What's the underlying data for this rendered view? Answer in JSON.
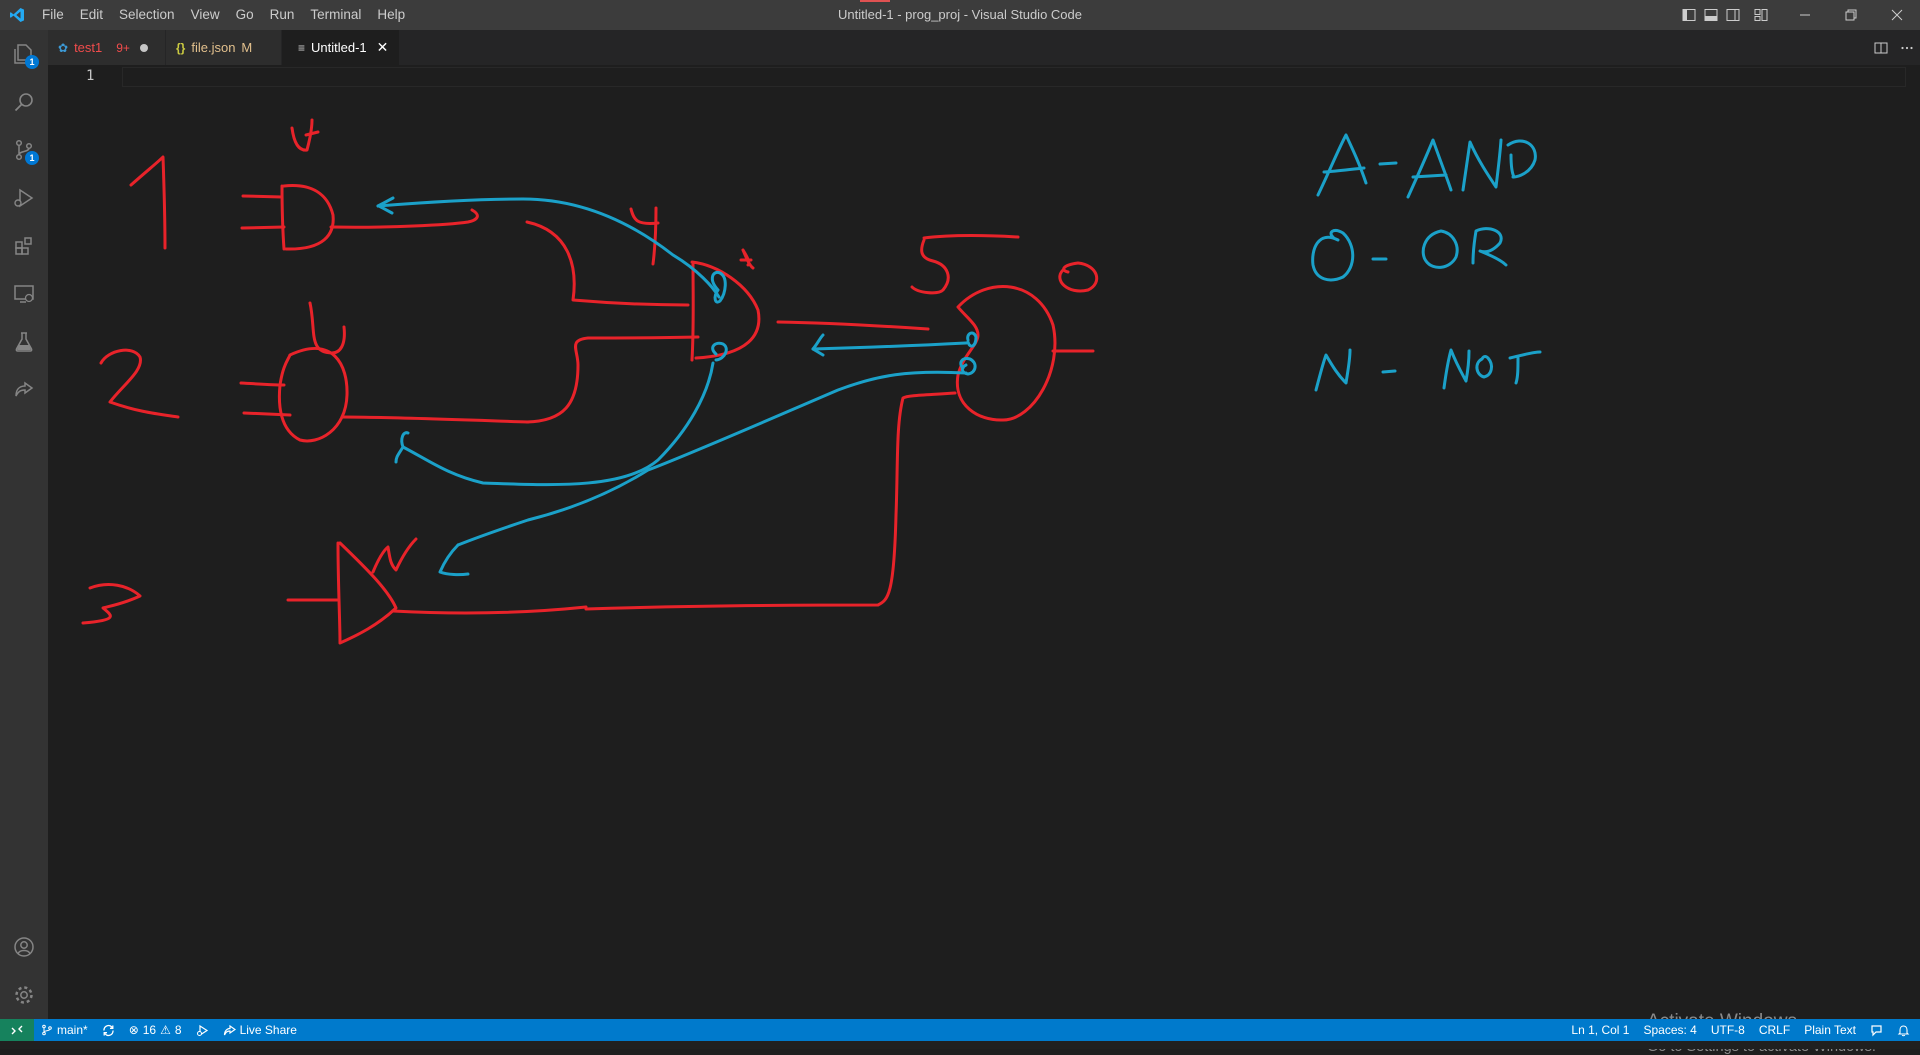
{
  "window": {
    "title": "Untitled-1 - prog_proj - Visual Studio Code"
  },
  "menu": [
    "File",
    "Edit",
    "Selection",
    "View",
    "Go",
    "Run",
    "Terminal",
    "Help"
  ],
  "activity": {
    "explorer_badge": "1",
    "scm_badge": "1"
  },
  "tabs": [
    {
      "label": "test1",
      "status": "9+",
      "icon": "python-icon",
      "color": "#f14c4c"
    },
    {
      "label": "file.json",
      "status": "M",
      "icon": "json-braces-icon",
      "color": "#e2c08d"
    },
    {
      "label": "Untitled-1",
      "icon": "text-file-icon",
      "color": "#ffffff"
    }
  ],
  "editor": {
    "line_number": "1",
    "drawing": {
      "left_numbers": [
        "1",
        "2",
        "3"
      ],
      "gate_labels": [
        "A",
        "O",
        "N",
        "4",
        "A",
        "5",
        "O"
      ],
      "legend": [
        "A-AND",
        "O-OR",
        "N-NOT"
      ],
      "colors": {
        "red": "#e8232a",
        "blue": "#1ba1c9"
      }
    }
  },
  "watermark": {
    "title": "Activate Windows",
    "subtitle": "Go to Settings to activate Windows."
  },
  "statusbar": {
    "branch": "main*",
    "errors": "16",
    "warnings": "8",
    "live_share": "Live Share",
    "position": "Ln 1, Col 1",
    "spaces": "Spaces: 4",
    "encoding": "UTF-8",
    "eol": "CRLF",
    "language": "Plain Text"
  },
  "colors": {
    "titlebar": "#3c3c3c",
    "activitybar": "#333333",
    "editor_bg": "#1e1e1e",
    "statusbar": "#007acc",
    "remote": "#16825d"
  }
}
